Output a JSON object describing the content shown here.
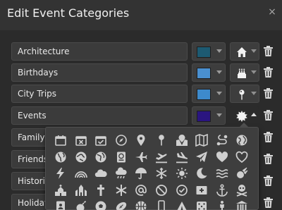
{
  "dialog": {
    "title": "Edit Event Categories",
    "close_symbol": "×"
  },
  "categories": [
    {
      "name": "Architecture",
      "color": "#1d5a72",
      "icon": "house-icon"
    },
    {
      "name": "Birthdays",
      "color": "#4a90d0",
      "icon": "cake-icon"
    },
    {
      "name": "City Trips",
      "color": "#3d8acc",
      "icon": "map-pin-icon"
    },
    {
      "name": "Events",
      "color": "#2a1580",
      "icon": "starburst-icon"
    },
    {
      "name": "Family",
      "color": "",
      "icon": ""
    },
    {
      "name": "Friends",
      "color": "",
      "icon": ""
    },
    {
      "name": "Historical",
      "color": "",
      "icon": ""
    },
    {
      "name": "Holidays",
      "color": "",
      "icon": ""
    }
  ],
  "icon_dropdown": {
    "rows": [
      [
        "calendar-icon",
        "calendar-x-icon",
        "calendar-check-icon",
        "compass-icon",
        "map-marker-icon",
        "pin-icon",
        "map-icon",
        "folded-map-icon",
        "route-icon",
        "globe-icon"
      ],
      [
        "globe-americas-icon",
        "globe-asia-icon",
        "globe-europe-icon",
        "passport-icon",
        "plane-icon",
        "plane-departure-icon",
        "plane-arrival-icon",
        "paper-plane-icon",
        "heart-icon",
        "heart-outline-icon"
      ],
      [
        "bolt-icon",
        "rainbow-icon",
        "cloud-icon",
        "cloud-rain-icon",
        "umbrella-icon",
        "snowflake-icon",
        "sun-icon",
        "moon-icon",
        "water-icon",
        "meteor-icon"
      ],
      [
        "church-icon",
        "place-of-worship-icon",
        "cross-icon",
        "asterisk-icon",
        "at-icon",
        "ban-icon",
        "check-circle-icon",
        "first-aid-icon",
        "anchor-icon",
        "skull-crossbones-icon"
      ],
      [
        "id-badge-icon",
        "bomb-icon",
        "soccer-ball-icon",
        "football-icon",
        "basketball-icon",
        "mobile-icon",
        "tent-icon",
        "dice-icon",
        "person-icon",
        "museum-icon"
      ]
    ]
  }
}
